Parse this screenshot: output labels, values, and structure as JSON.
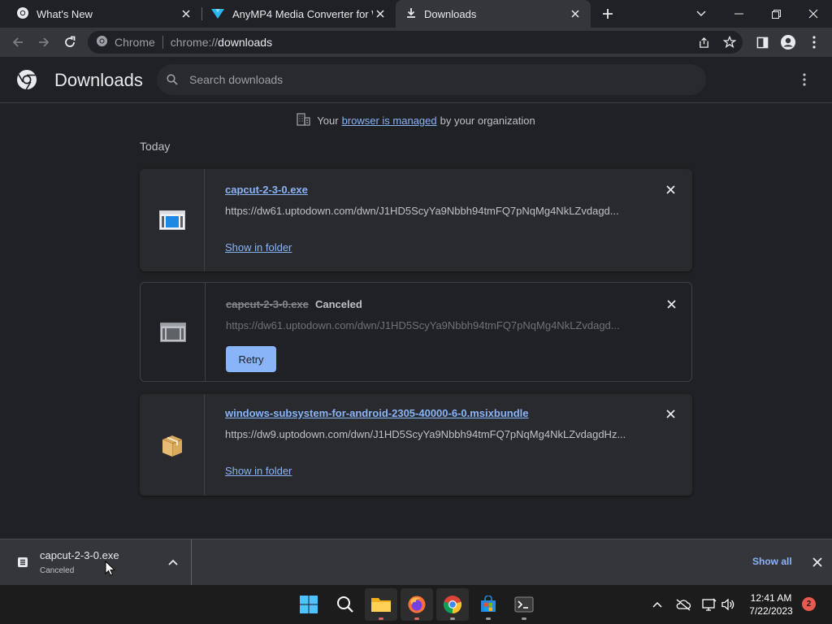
{
  "tabs": [
    {
      "title": "What's New",
      "icon": "chrome-icon",
      "active": false
    },
    {
      "title": "AnyMP4 Media Converter for Wi",
      "icon": "anymp4-icon",
      "active": false
    },
    {
      "title": "Downloads",
      "icon": "download-icon",
      "active": true
    }
  ],
  "omnibox": {
    "site_label": "Chrome",
    "url_scheme": "chrome://",
    "url_path": "downloads"
  },
  "page": {
    "title": "Downloads",
    "search_placeholder": "Search downloads",
    "managed": {
      "prefix": "Your",
      "link": "browser is managed",
      "suffix": "by your organization"
    },
    "section_date": "Today"
  },
  "downloads": [
    {
      "file_name": "capcut-2-3-0.exe",
      "url": "https://dw61.uptodown.com/dwn/J1HD5ScyYa9Nbbh94tmFQ7pNqMg4NkLZvdagd...",
      "action": "Show in folder",
      "status": "",
      "icon": "exe-file-icon"
    },
    {
      "file_name": "capcut-2-3-0.exe",
      "url": "https://dw61.uptodown.com/dwn/J1HD5ScyYa9Nbbh94tmFQ7pNqMg4NkLZvdagd...",
      "action": "Retry",
      "status": "Canceled",
      "icon": "exe-file-icon"
    },
    {
      "file_name": "windows-subsystem-for-android-2305-40000-6-0.msixbundle",
      "url": "https://dw9.uptodown.com/dwn/J1HD5ScyYa9Nbbh94tmFQ7pNqMg4NkLZvdagdHz...",
      "action": "Show in folder",
      "status": "",
      "icon": "package-icon"
    }
  ],
  "shelf": {
    "file_name": "capcut-2-3-0.exe",
    "status": "Canceled",
    "show_all": "Show all"
  },
  "taskbar": {
    "time": "12:41 AM",
    "date": "7/22/2023",
    "notification_count": "2"
  },
  "colors": {
    "accent": "#8ab4f8",
    "background": "#202124",
    "card": "#292a2d",
    "toolbar": "#35363a"
  }
}
